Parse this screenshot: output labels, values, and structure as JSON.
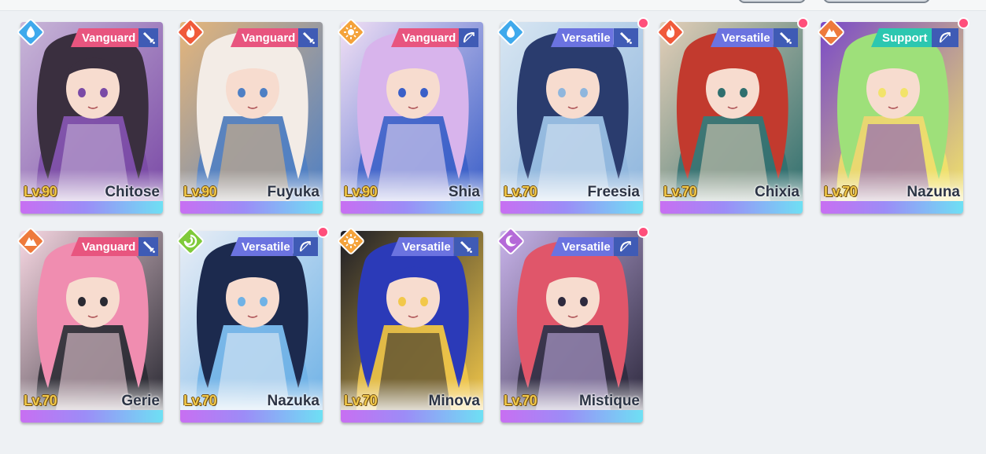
{
  "colors": {
    "page_bg": "#eef1f4",
    "vanguard": "#e8557f",
    "versatile": "#6b73e0",
    "support": "#2cc7b0",
    "weapon_bg": "#3f5bb5",
    "level_text": "#f2c94a",
    "notify_dot": "#ff4f7b"
  },
  "element_colors": {
    "water": "#3fa9ec",
    "fire": "#f05a3a",
    "light": "#f4a23a",
    "earth": "#ee7a3c",
    "wind": "#7fca3a",
    "moon": "#b46ad8"
  },
  "characters": [
    {
      "name": "Chitose",
      "level": "Lv.90",
      "role": "Vanguard",
      "element": "water",
      "weapon": "sword-icon",
      "notification": false,
      "palette": [
        "#3a2f3f",
        "#7a4aa6",
        "#c9b7d8"
      ]
    },
    {
      "name": "Fuyuka",
      "level": "Lv.90",
      "role": "Vanguard",
      "element": "fire",
      "weapon": "sword-icon",
      "notification": false,
      "palette": [
        "#f3ece6",
        "#4e7fc4",
        "#e6b67a"
      ]
    },
    {
      "name": "Shia",
      "level": "Lv.90",
      "role": "Vanguard",
      "element": "light",
      "weapon": "bow-icon",
      "notification": false,
      "palette": [
        "#d8b4ec",
        "#3a5fc8",
        "#f1dff4"
      ]
    },
    {
      "name": "Freesia",
      "level": "Lv.70",
      "role": "Versatile",
      "element": "water",
      "weapon": "sword-icon",
      "notification": true,
      "palette": [
        "#2a3c6e",
        "#8fb6dd",
        "#d8e6f2"
      ]
    },
    {
      "name": "Chixia",
      "level": "Lv.70",
      "role": "Versatile",
      "element": "fire",
      "weapon": "sword-icon",
      "notification": true,
      "palette": [
        "#c23a2e",
        "#2f6f6e",
        "#e4cfb8"
      ]
    },
    {
      "name": "Nazuna",
      "level": "Lv.70",
      "role": "Support",
      "element": "earth",
      "weapon": "bow-icon",
      "notification": true,
      "palette": [
        "#9ee07a",
        "#f2e36a",
        "#7a4ac8"
      ]
    },
    {
      "name": "Gerie",
      "level": "Lv.70",
      "role": "Vanguard",
      "element": "earth",
      "weapon": "sword-icon",
      "notification": false,
      "palette": [
        "#f08db0",
        "#2a2a33",
        "#f7d7e2"
      ]
    },
    {
      "name": "Nazuka",
      "level": "Lv.70",
      "role": "Versatile",
      "element": "wind",
      "weapon": "bow-icon",
      "notification": true,
      "palette": [
        "#1c2a4e",
        "#6fb2e6",
        "#e9eef6"
      ]
    },
    {
      "name": "Minova",
      "level": "Lv.70",
      "role": "Versatile",
      "element": "light",
      "weapon": "sword-icon",
      "notification": false,
      "palette": [
        "#2b3ab8",
        "#f2c84a",
        "#1d1d26"
      ]
    },
    {
      "name": "Mistique",
      "level": "Lv.70",
      "role": "Versatile",
      "element": "moon",
      "weapon": "bow-icon",
      "notification": true,
      "palette": [
        "#e0566a",
        "#2e2a3e",
        "#c8b3ea"
      ]
    }
  ]
}
